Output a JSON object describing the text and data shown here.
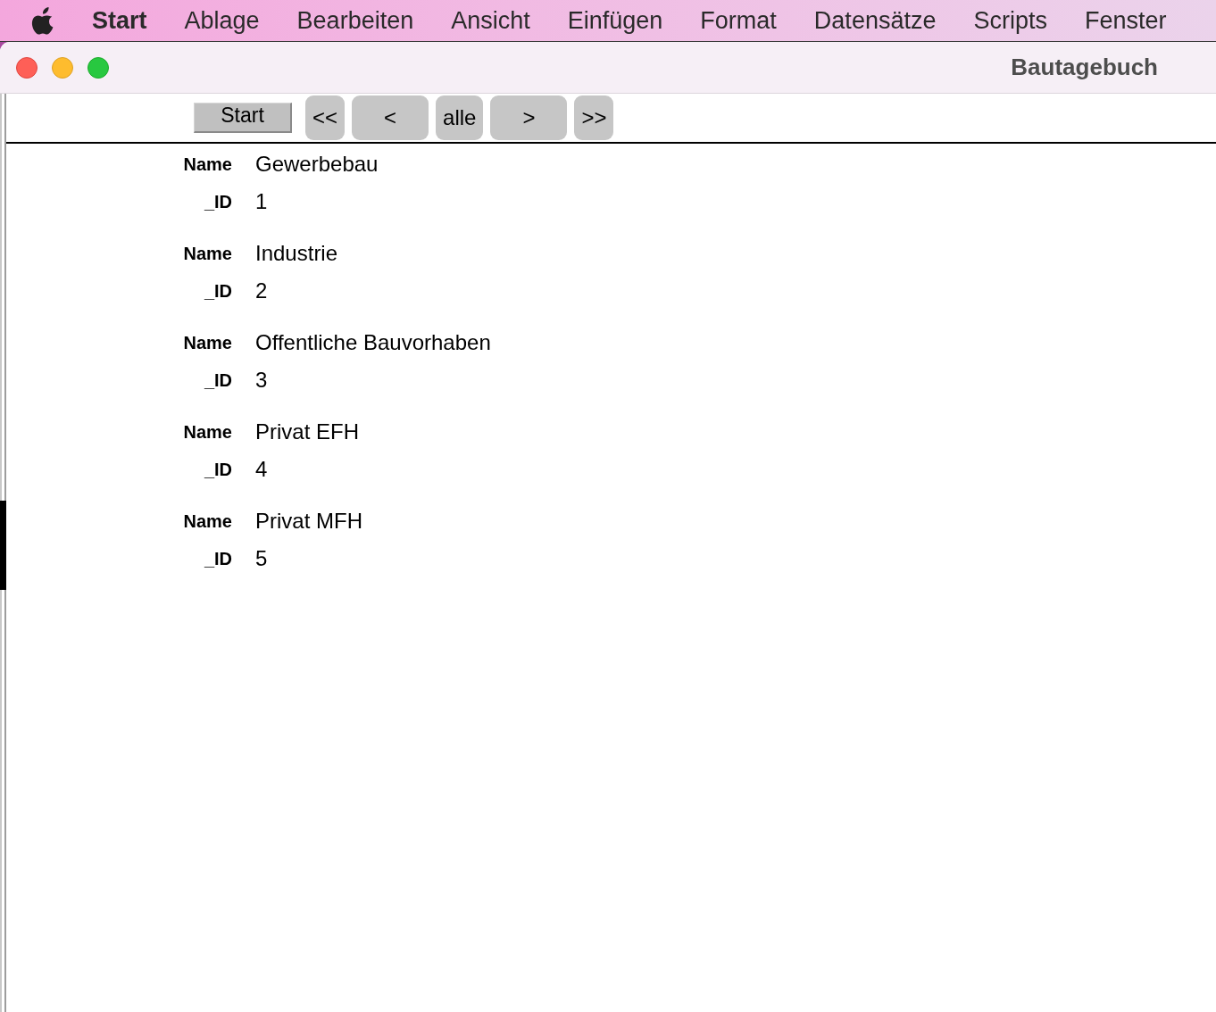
{
  "menu_bar": {
    "app_name": "Start",
    "items": [
      "Ablage",
      "Bearbeiten",
      "Ansicht",
      "Einfügen",
      "Format",
      "Datensätze",
      "Scripts",
      "Fenster"
    ]
  },
  "window": {
    "title": "Bautagebuch"
  },
  "toolbar": {
    "buttons": [
      {
        "label": "Start",
        "kind": "flat"
      },
      {
        "label": "<<",
        "kind": "narrow"
      },
      {
        "label": "<",
        "kind": "wide"
      },
      {
        "label": "alle",
        "kind": "narrow"
      },
      {
        "label": ">",
        "kind": "wide"
      },
      {
        "label": ">>",
        "kind": "narrow"
      }
    ]
  },
  "records": [
    {
      "selected": false,
      "fields": [
        {
          "label": "Name",
          "value": "Gewerbebau"
        },
        {
          "label": "_ID",
          "value": "1"
        }
      ]
    },
    {
      "selected": false,
      "fields": [
        {
          "label": "Name",
          "value": "Industrie"
        },
        {
          "label": "_ID",
          "value": "2"
        }
      ]
    },
    {
      "selected": false,
      "fields": [
        {
          "label": "Name",
          "value": "Offentliche Bauvorhaben"
        },
        {
          "label": "_ID",
          "value": "3"
        }
      ]
    },
    {
      "selected": false,
      "fields": [
        {
          "label": "Name",
          "value": "Privat EFH"
        },
        {
          "label": "_ID",
          "value": "4"
        }
      ]
    },
    {
      "selected": true,
      "fields": [
        {
          "label": "Name",
          "value": "Privat MFH"
        },
        {
          "label": "_ID",
          "value": "5"
        }
      ]
    }
  ]
}
